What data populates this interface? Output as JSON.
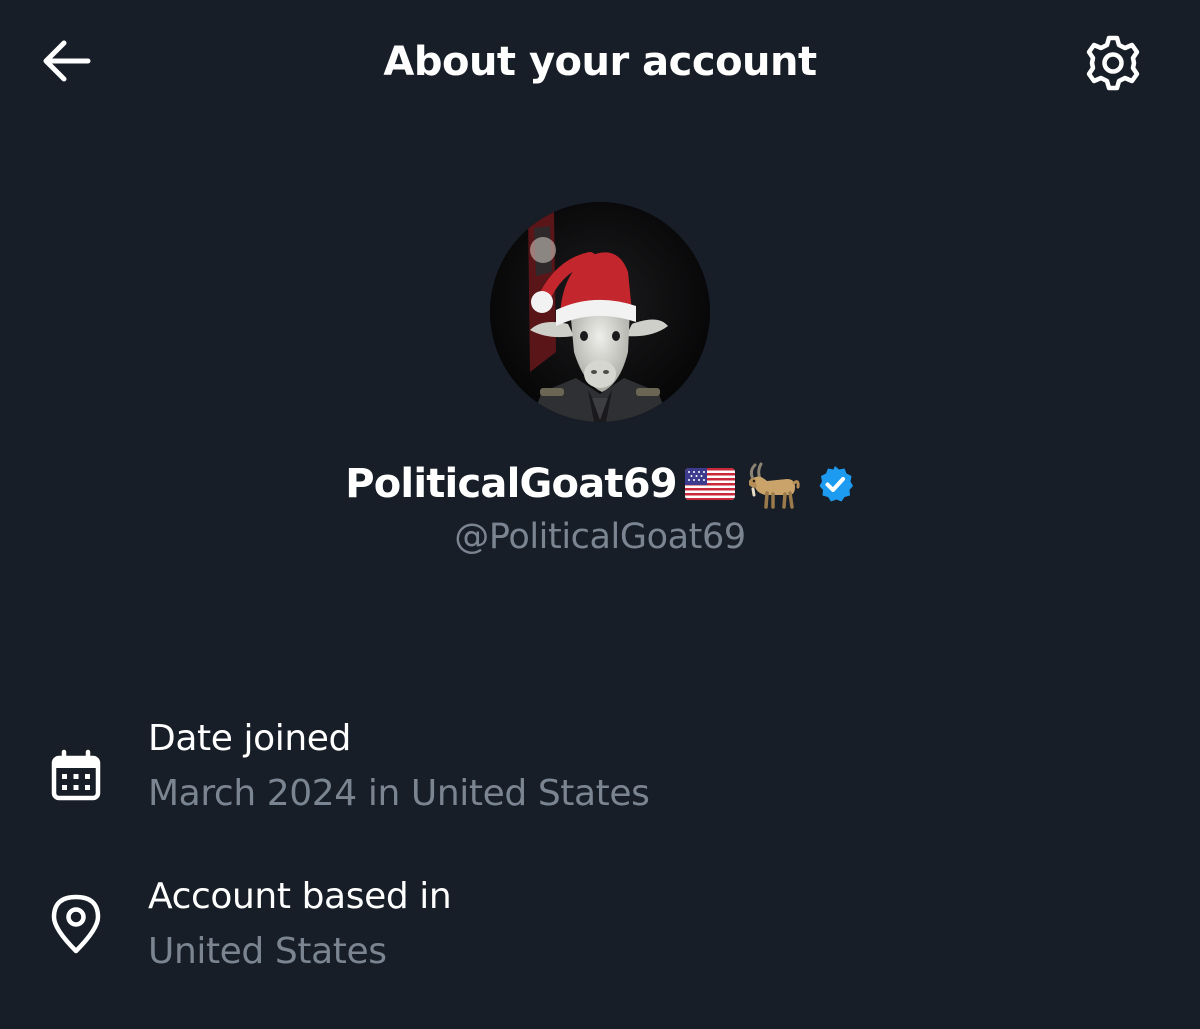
{
  "header": {
    "title": "About your account",
    "back_icon": "arrow-left-icon",
    "settings_icon": "gear-icon"
  },
  "profile": {
    "display_name": "PoliticalGoat69",
    "name_emojis": [
      "🇺🇸",
      "🐐"
    ],
    "verified": true,
    "handle": "@PoliticalGoat69"
  },
  "info": {
    "date_joined": {
      "icon": "calendar-icon",
      "title": "Date joined",
      "value": "March 2024 in United States"
    },
    "account_based_in": {
      "icon": "location-pin-icon",
      "title": "Account based in",
      "value": "United States"
    }
  },
  "colors": {
    "background": "#171e27",
    "primary_text": "#ffffff",
    "secondary_text": "#7b8591",
    "verified_blue": "#1d9bf0"
  }
}
